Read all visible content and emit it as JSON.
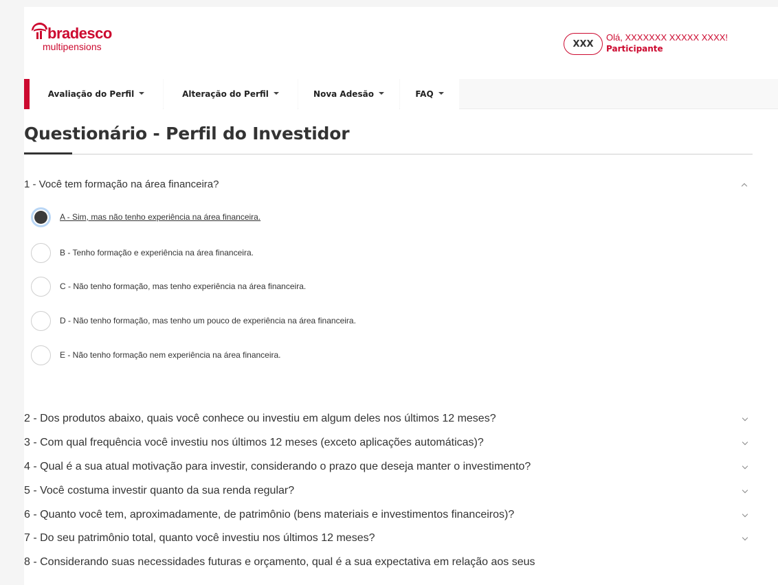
{
  "header": {
    "brand": "bradesco",
    "brand_sub": "multipensions",
    "user_initials": "XXX",
    "greeting": "Olá, XXXXXXX XXXXX XXXX!",
    "role": "Participante"
  },
  "nav": {
    "items": [
      {
        "label": "Avaliação do Perfil"
      },
      {
        "label": "Alteração do Perfil"
      },
      {
        "label": "Nova Adesão"
      },
      {
        "label": "FAQ"
      }
    ]
  },
  "page_title": "Questionário - Perfil do Investidor",
  "questions": [
    {
      "label": "1 - Você tem formação na área financeira?",
      "expanded": true,
      "options": [
        {
          "label": "A - Sim, mas não tenho experiência na área financeira.",
          "selected": true
        },
        {
          "label": "B - Tenho formação e experiência na área financeira.",
          "selected": false
        },
        {
          "label": "C - Não tenho formação, mas tenho experiência na área financeira.",
          "selected": false
        },
        {
          "label": "D - Não tenho formação, mas tenho um pouco de experiência na área financeira.",
          "selected": false
        },
        {
          "label": "E - Não tenho formação nem experiência na área financeira.",
          "selected": false
        }
      ]
    },
    {
      "label": "2 - Dos produtos abaixo, quais você conhece ou investiu em algum deles nos últimos 12 meses?",
      "expanded": false
    },
    {
      "label": "3 - Com qual frequência você investiu nos últimos 12 meses (exceto aplicações automáticas)?",
      "expanded": false
    },
    {
      "label": "4 - Qual é a sua atual motivação para investir, considerando o prazo que deseja manter o investimento?",
      "expanded": false
    },
    {
      "label": "5 - Você costuma investir quanto da sua renda regular?",
      "expanded": false
    },
    {
      "label": "6 - Quanto você tem, aproximadamente, de patrimônio (bens materiais e investimentos financeiros)?",
      "expanded": false
    },
    {
      "label": "7 - Do seu patrimônio total, quanto você investiu nos últimos 12 meses?",
      "expanded": false
    },
    {
      "label": "8 - Considerando suas necessidades futuras e orçamento, qual é a sua expectativa em relação aos seus",
      "expanded": false
    }
  ],
  "colors": {
    "brand_red": "#cc092f",
    "radio_focus": "#b9d6f5",
    "radio_dot": "#3b3b3b"
  }
}
